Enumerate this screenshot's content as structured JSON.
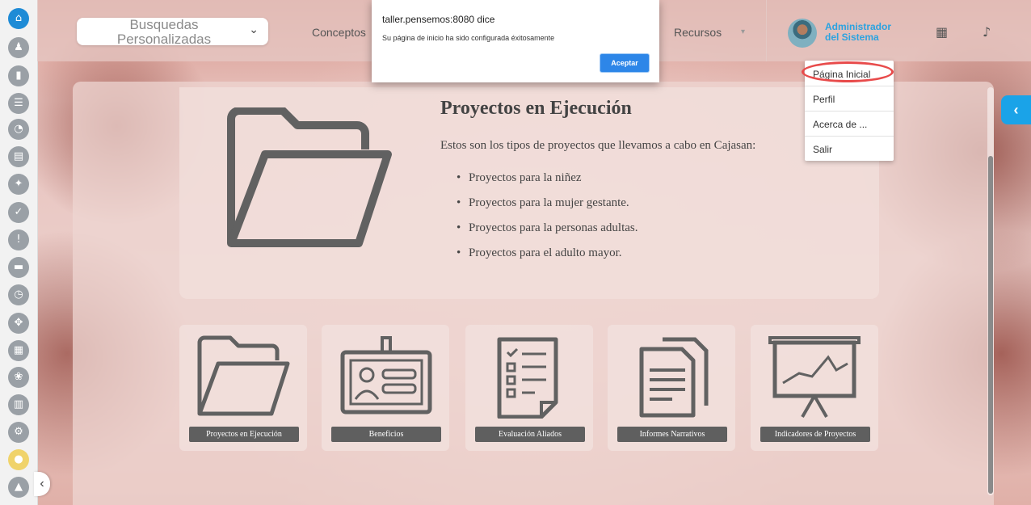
{
  "header": {
    "search_select": "Busquedas Personalizadas",
    "nav": [
      "Conceptos",
      "Recursos"
    ],
    "user": {
      "line1": "Administrador",
      "line2": "del Sistema"
    }
  },
  "dialog": {
    "origin": "taller.pensemos:8080 dice",
    "message": "Su página de inicio ha sido configurada éxitosamente",
    "ok_label": "Aceptar"
  },
  "user_menu": [
    "Página Inicial",
    "Perfil",
    "Acerca de ...",
    "Salir"
  ],
  "hero": {
    "title": "Proyectos en Ejecución",
    "description": "Estos son los tipos de proyectos que llevamos a cabo en Cajasan:",
    "items": [
      "Proyectos para la niñez",
      "Proyectos para la mujer gestante.",
      "Proyectos para la personas adultas.",
      "Proyectos para el adulto mayor."
    ]
  },
  "cards": [
    {
      "label": "Proyectos en Ejecución",
      "icon": "folder-icon"
    },
    {
      "label": "Beneficios",
      "icon": "id-badge-icon"
    },
    {
      "label": "Evaluación Aliados",
      "icon": "checklist-icon"
    },
    {
      "label": "Informes Narrativos",
      "icon": "documents-icon"
    },
    {
      "label": "Indicadores de Proyectos",
      "icon": "presentation-chart-icon"
    }
  ],
  "sidebar_icons": [
    "home-icon",
    "user-icon",
    "bar-chart-icon",
    "list-icon",
    "pie-chart-icon",
    "document-icon",
    "award-icon",
    "check-icon",
    "alert-icon",
    "screen-icon",
    "clock-icon",
    "move-icon",
    "grid-icon",
    "lotus-icon",
    "report-icon",
    "gear-icon",
    "lightbulb-icon",
    "warning-icon"
  ],
  "colors": {
    "accent": "#1aa3e8",
    "home": "#1e8bd6",
    "user_name": "#2ba3e0",
    "highlight": "#e84b4b",
    "dialog_button": "#2d86e8"
  }
}
